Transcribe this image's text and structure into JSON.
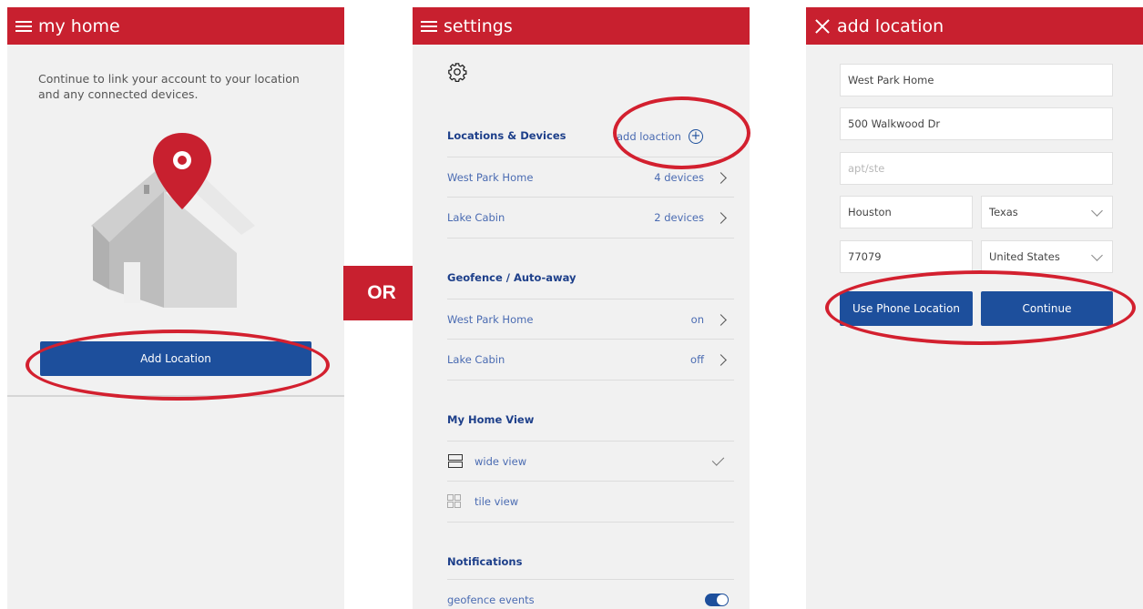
{
  "separator": "OR",
  "panel1": {
    "title": "my home",
    "intro": "Continue to link your account to your location and any connected devices.",
    "add_button": "Add Location"
  },
  "panel2": {
    "title": "settings",
    "section1": "Locations & Devices",
    "add_link": "add loaction",
    "locations": [
      {
        "name": "West Park Home",
        "value": "4 devices"
      },
      {
        "name": "Lake Cabin",
        "value": "2 devices"
      }
    ],
    "section2": "Geofence / Auto-away",
    "geofence": [
      {
        "name": "West Park Home",
        "value": "on"
      },
      {
        "name": "Lake Cabin",
        "value": "off"
      }
    ],
    "section3": "My Home View",
    "views": [
      {
        "name": "wide view"
      },
      {
        "name": "tile view"
      }
    ],
    "section4": "Notifications",
    "notifications": [
      {
        "name": "geofence events"
      }
    ]
  },
  "panel3": {
    "title": "add location",
    "name_value": "West Park Home",
    "street_value": "500 Walkwood Dr",
    "apt_placeholder": "apt/ste",
    "city_value": "Houston",
    "state_value": "Texas",
    "zip_value": "77079",
    "country_value": "United States",
    "phone_button": "Use Phone Location",
    "continue_button": "Continue"
  },
  "colors": {
    "header": "#c8202f",
    "button": "#1d4f9c",
    "highlight": "#d3202f"
  }
}
